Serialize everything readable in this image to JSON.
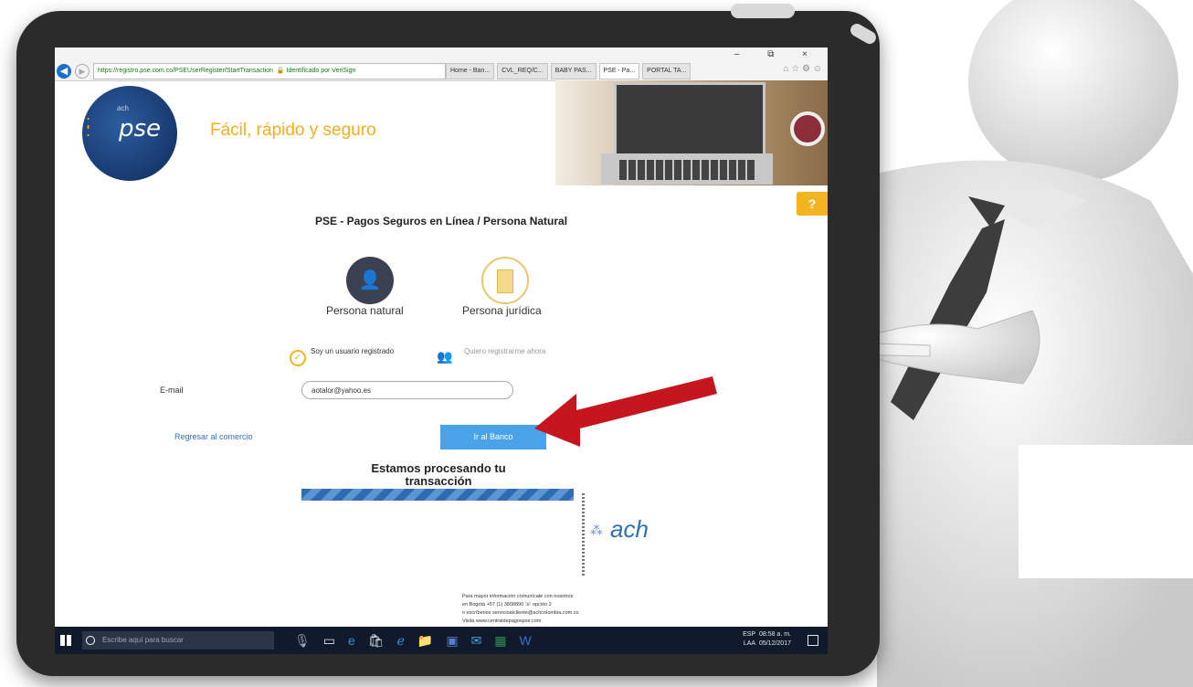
{
  "browser": {
    "address": "https://registro.pse.com.co/PSEUserRegister/StartTransaction",
    "security_badge": "Identificado por VeriSign",
    "tabs": [
      "Home - Ban...",
      "CVL_REQ/C...",
      "BABY PAS...",
      "PSE - Pa...",
      "PORTAL TA..."
    ],
    "window_controls": "– ⧉ ×",
    "toolbar_icons": "⌂ ☆ ⚙ ☺"
  },
  "header": {
    "logo_small": "ach",
    "logo_text": "pse",
    "slogan": "Fácil, rápido y seguro",
    "help_label": "?"
  },
  "form": {
    "title": "PSE - Pagos Seguros en Línea / Persona Natural",
    "option_natural": "Persona natural",
    "option_juridica": "Persona jurídica",
    "registered_label": "Soy un usuario registrado",
    "register_now_label": "Quiero registrarme ahora",
    "email_label": "E-mail",
    "email_value": "aotalor@yahoo.es",
    "back_link": "Regresar al comercio",
    "submit_label": "Ir al Banco"
  },
  "processing": {
    "line1": "Estamos procesando tu",
    "line2": "transacción",
    "progress": 1.0
  },
  "footer": {
    "ach_logo": "ach",
    "contact_lines": [
      "Para mayor información comunícate con nosotros",
      "en Bogotá +57 (1) 3808890 ☏ opción 2",
      "o escríbenos servicioalcliente@achcolombia.com.co",
      "Visita www.centraldepagospse.com"
    ]
  },
  "taskbar": {
    "search_placeholder": "Escribe aquí para buscar",
    "lang": "ESP",
    "lang2": "LAA",
    "time": "08:58 a. m.",
    "date": "05/12/2017"
  },
  "colors": {
    "accent": "#f2b51f",
    "button": "#4aa3e8",
    "arrow": "#c4161c",
    "logo": "#1a3a72"
  }
}
